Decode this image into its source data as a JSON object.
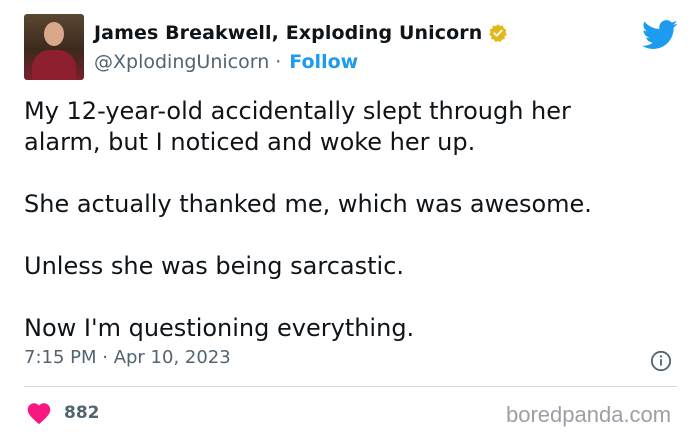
{
  "author": {
    "name": "James Breakwell, Exploding Unicorn",
    "handle": "@XplodingUnicorn",
    "separator": "·",
    "follow_label": "Follow",
    "verified_icon": "verified-badge-icon",
    "avatar": "author-avatar"
  },
  "brand_icon": "twitter-bird-icon",
  "tweet": {
    "paragraphs": [
      "My 12-year-old accidentally slept through her\nalarm, but I noticed and woke her up.",
      "She actually thanked me, which was awesome.",
      "Unless she was being sarcastic.",
      "Now I'm questioning everything."
    ],
    "timestamp": "7:15 PM · Apr 10, 2023"
  },
  "engagement": {
    "likes": "882",
    "like_icon": "heart-icon",
    "info_icon": "info-icon"
  },
  "watermark": "boredpanda.com",
  "colors": {
    "text": "#0f1419",
    "muted": "#536471",
    "accent": "#1d9bf0",
    "heart": "#f91880",
    "verified": "#e2b719"
  }
}
